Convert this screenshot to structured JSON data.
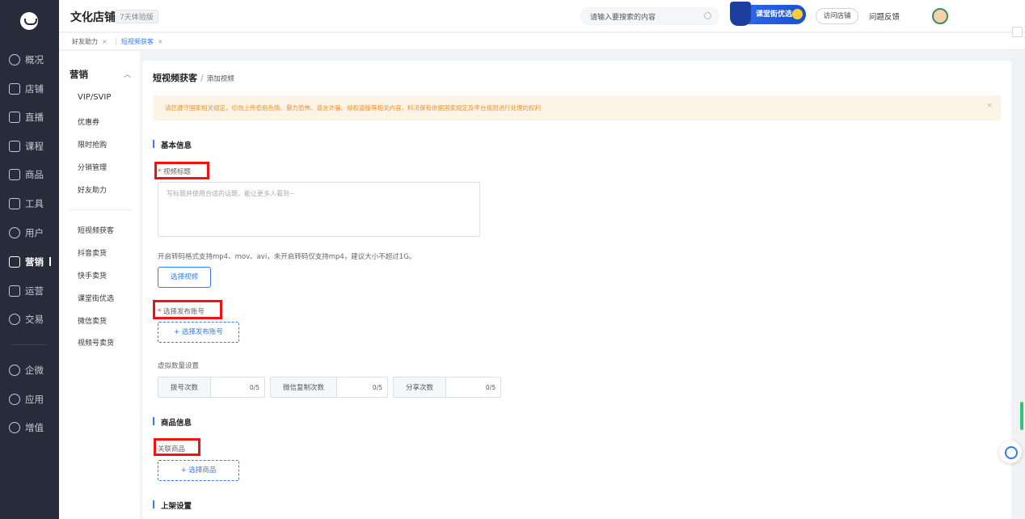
{
  "sidebar": {
    "items": [
      {
        "label": "概况",
        "icon": "chart-icon"
      },
      {
        "label": "店铺",
        "icon": "store-icon"
      },
      {
        "label": "直播",
        "icon": "video-icon"
      },
      {
        "label": "课程",
        "icon": "book-icon"
      },
      {
        "label": "商品",
        "icon": "goods-icon"
      },
      {
        "label": "工具",
        "icon": "toolbox-icon"
      },
      {
        "label": "用户",
        "icon": "user-icon"
      },
      {
        "label": "营销",
        "icon": "marketing-icon",
        "active": true
      },
      {
        "label": "运营",
        "icon": "monitor-icon"
      },
      {
        "label": "交易",
        "icon": "trade-icon"
      },
      {
        "label": "企微",
        "icon": "wecom-icon"
      },
      {
        "label": "应用",
        "icon": "apps-icon"
      },
      {
        "label": "增值",
        "icon": "addon-icon"
      }
    ]
  },
  "header": {
    "store_name": "文化店铺",
    "trial_badge": "7天体验版",
    "search_placeholder": "请输入要搜索的内容",
    "promo_label": "课堂街优选",
    "visit_store": "访问店铺",
    "feedback": "问题反馈"
  },
  "tabs": [
    {
      "label": "好友助力",
      "close": "×"
    },
    {
      "label": "短视频获客",
      "close": "×",
      "active": true
    }
  ],
  "submenu": {
    "title": "营销",
    "group1": [
      "VIP/SVIP",
      "优惠券",
      "限时抢购",
      "分销管理",
      "好友助力"
    ],
    "group2": [
      "短视频获客",
      "抖音卖货",
      "快手卖货",
      "课堂街优选",
      "微信卖货",
      "视频号卖货"
    ]
  },
  "main": {
    "breadcrumb_root": "短视频获客",
    "breadcrumb_sep": "/",
    "breadcrumb_current": "添加视频",
    "notice": "请您遵守国家相关规定，切勿上传低俗色情、暴力恐怖、谣言诈骗、侵权盗版等相关内容，料汛保有依据国家规定及平台规则进行处理的权利",
    "notice_close": "×",
    "section_basic": "基本信息",
    "title_label_star": "*",
    "title_label": "视频标题",
    "title_placeholder": "写标题并使用合适的话题，能让更多人看到~",
    "upload_hint": "开启转码格式支持mp4、mov、avi，未开启转码仅支持mp4，建议大小不超过1G。",
    "select_video": "选择视频",
    "account_label_star": "*",
    "account_label": "选择发布账号",
    "select_account": "+ 选择发布账号",
    "virtual_title": "虚拟数量设置",
    "virtual": [
      {
        "label": "拨号次数",
        "value": "0/5"
      },
      {
        "label": "微信复制次数",
        "value": "0/5"
      },
      {
        "label": "分享次数",
        "value": "0/5"
      }
    ],
    "section_goods": "商品信息",
    "goods_label": "关联商品",
    "select_goods": "+ 选择商品",
    "section_shelf": "上架设置"
  },
  "colors": {
    "accent": "#2f7cf5",
    "highlight": "#f21212",
    "sidebar": "#262c3a",
    "notice_text": "#e6932f"
  }
}
